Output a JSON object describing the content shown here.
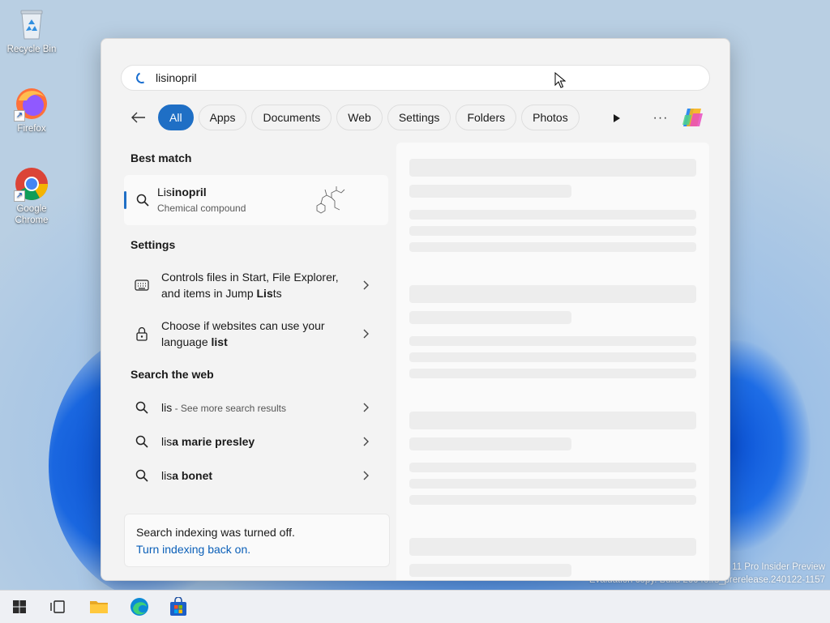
{
  "desktop": {
    "icons": [
      {
        "label": "Recycle Bin"
      },
      {
        "label": "Firefox"
      },
      {
        "label": "Google Chrome"
      }
    ],
    "watermark_line1": "11 Pro Insider Preview",
    "watermark_line2": "Evaluation copy. Build 26040.rs_prerelease.240122-1157"
  },
  "search": {
    "query": "lisinopril",
    "filters": [
      "All",
      "Apps",
      "Documents",
      "Web",
      "Settings",
      "Folders",
      "Photos"
    ],
    "active_filter": "All",
    "play_icon": "play-icon",
    "more_label": "···"
  },
  "best_match": {
    "heading": "Best match",
    "title_plain": "Lis",
    "title_bold": "inopril",
    "subtitle": "Chemical compound",
    "icon": "search-icon"
  },
  "settings": {
    "heading": "Settings",
    "items": [
      {
        "line1": "Controls files in Start, File Explorer,",
        "line2_plain": "and items in Jump ",
        "line2_bold": "Lis",
        "line2_rest": "ts",
        "icon": "keyboard-icon"
      },
      {
        "line1": "Choose if websites can use your",
        "line2_plain": "language ",
        "line2_bold": "list",
        "line2_rest": "",
        "icon": "lock-icon"
      }
    ]
  },
  "web": {
    "heading": "Search the web",
    "items": [
      {
        "plain": "lis",
        "suffix": " - See more search results",
        "bold": ""
      },
      {
        "plain": "lis",
        "suffix": "",
        "bold": "a marie presley"
      },
      {
        "plain": "lis",
        "suffix": "",
        "bold": "a bonet"
      }
    ]
  },
  "notice": {
    "line1": "Search indexing was turned off.",
    "link": "Turn indexing back on."
  },
  "colors": {
    "accent": "#1f6fc5",
    "link": "#0a5fb8",
    "panel_bg": "#f3f3f3"
  }
}
